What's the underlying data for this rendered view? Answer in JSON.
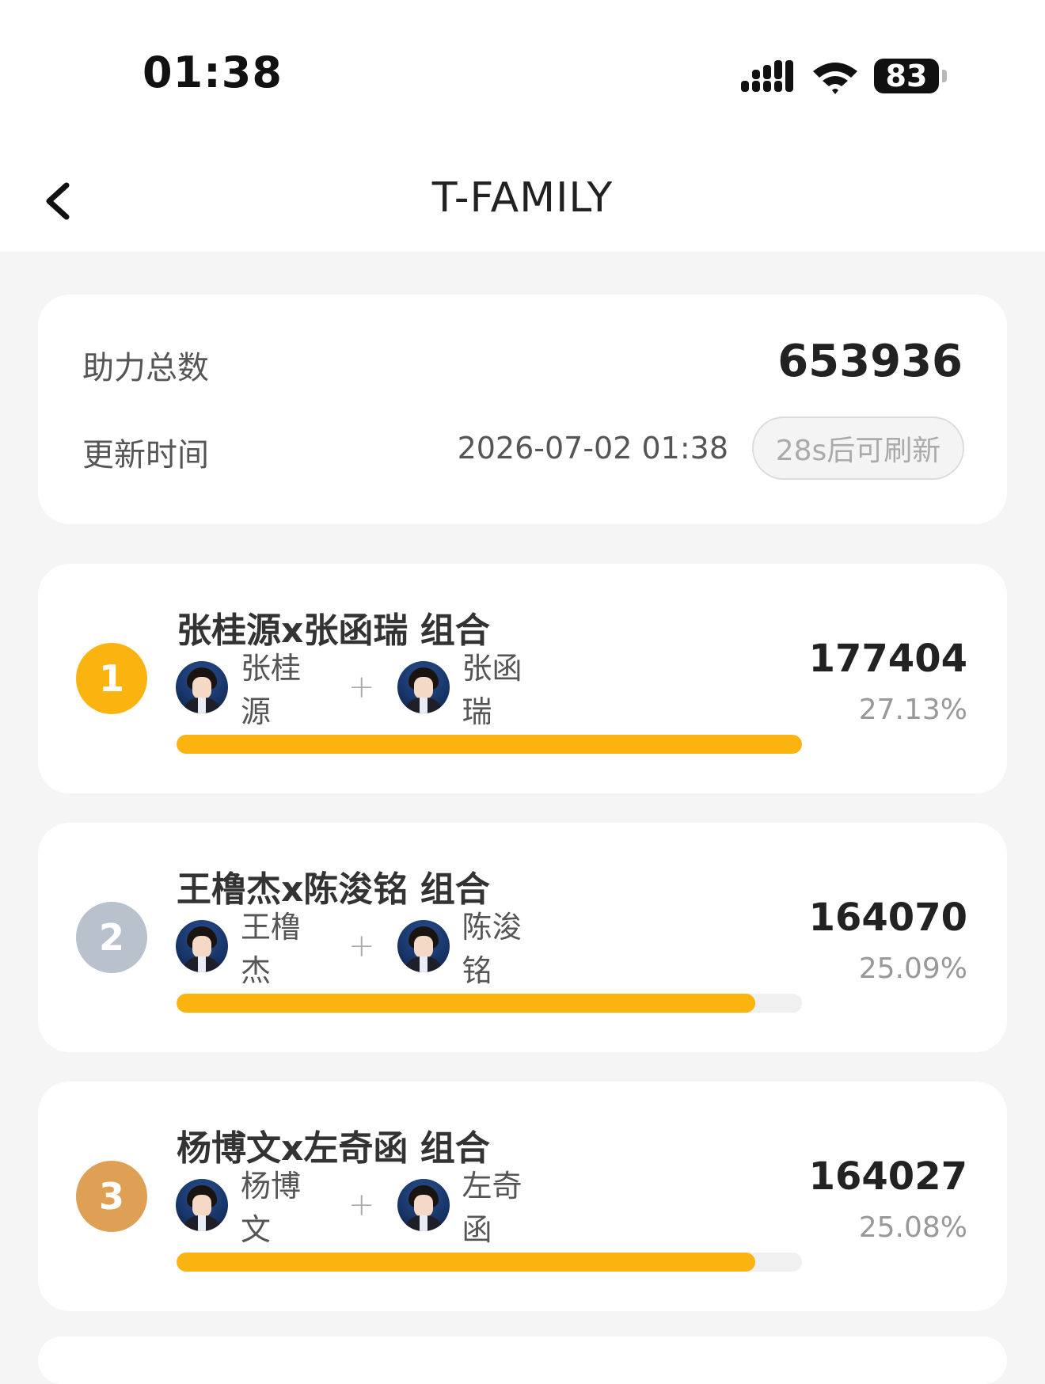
{
  "status_bar": {
    "time": "01:38",
    "battery": "83",
    "icons": [
      "signal-icon",
      "wifi-icon",
      "battery-icon"
    ]
  },
  "nav": {
    "title": "T-FAMILY",
    "back_icon": "chevron-left-icon"
  },
  "summary": {
    "total_label": "助力总数",
    "total_value": "653936",
    "update_label": "更新时间",
    "update_time": "2026-07-02 01:38",
    "refresh_label": "28s后可刷新"
  },
  "ranking": [
    {
      "rank": "1",
      "badge_color": "#fbb40f",
      "group_name": "张桂源x张函瑞 组合",
      "member_a": "张桂源",
      "member_b": "张函瑞",
      "plus": "+",
      "votes": "177404",
      "percent": "27.13%",
      "progress_fraction": 1.0
    },
    {
      "rank": "2",
      "badge_color": "#b8c1cc",
      "group_name": "王橹杰x陈浚铭 组合",
      "member_a": "王橹杰",
      "member_b": "陈浚铭",
      "plus": "+",
      "votes": "164070",
      "percent": "25.09%",
      "progress_fraction": 0.925
    },
    {
      "rank": "3",
      "badge_color": "#dea055",
      "group_name": "杨博文x左奇函 组合",
      "member_a": "杨博文",
      "member_b": "左奇函",
      "plus": "+",
      "votes": "164027",
      "percent": "25.08%",
      "progress_fraction": 0.925
    }
  ],
  "colors": {
    "accent": "#fbb40f",
    "background": "#f5f5f5",
    "card": "#ffffff"
  }
}
